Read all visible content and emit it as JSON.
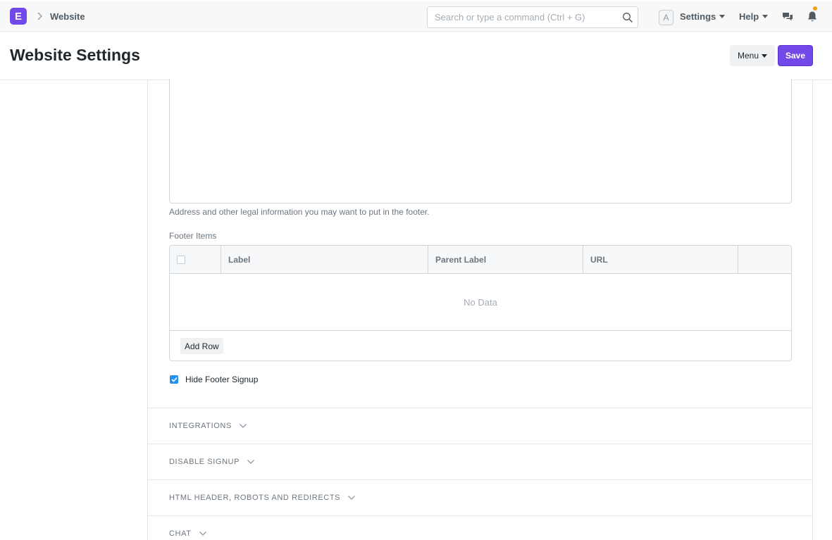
{
  "app": {
    "logo_letter": "E",
    "breadcrumb": "Website",
    "brand_color": "#7248e8"
  },
  "navbar": {
    "search_placeholder": "Search or type a command (Ctrl + G)",
    "avatar_letter": "A",
    "settings_label": "Settings",
    "help_label": "Help",
    "notification_dot_color": "#f59c1a"
  },
  "page": {
    "title": "Website Settings",
    "menu_label": "Menu",
    "save_label": "Save"
  },
  "form": {
    "footer_address_help": "Address and other legal information you may want to put in the footer.",
    "footer_items_label": "Footer Items",
    "footer_items": {
      "columns": [
        "Label",
        "Parent Label",
        "URL"
      ],
      "rows": [],
      "empty_text": "No Data",
      "add_row_label": "Add Row"
    },
    "hide_footer_signup": {
      "label": "Hide Footer Signup",
      "checked": true
    }
  },
  "sections": [
    {
      "title": "INTEGRATIONS",
      "collapsed": true
    },
    {
      "title": "DISABLE SIGNUP",
      "collapsed": true
    },
    {
      "title": "HTML HEADER, ROBOTS AND REDIRECTS",
      "collapsed": true
    },
    {
      "title": "CHAT",
      "collapsed": true
    }
  ]
}
